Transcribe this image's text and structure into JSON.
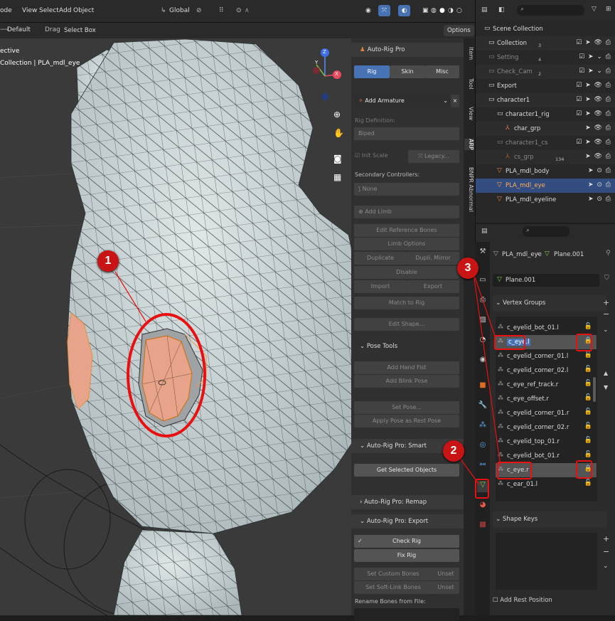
{
  "header": {
    "mode": "ode",
    "menus": [
      "View",
      "Select",
      "Add",
      "Object"
    ],
    "orientation": "Global",
    "pivot": "Default",
    "drag_label": "Drag:",
    "drag_value": "Select Box",
    "options_label": "Options"
  },
  "viewport": {
    "view_name": "ective",
    "object_info": "Collection | PLA_mdl_eye",
    "axis_x": "X",
    "axis_y": "Y",
    "axis_z": "Z"
  },
  "npanel": {
    "title": "Auto-Rig Pro",
    "tabs": [
      "Rig",
      "Skin",
      "Misc"
    ],
    "add_armature": "Add Armature",
    "rig_definition_label": "Rig Definition:",
    "rig_definition_value": "Biped",
    "init_scale": "Init Scale",
    "legacy": "Legacy...",
    "secondary_controllers": "Secondary Controllers:",
    "secondary_value": "None",
    "add_limb": "Add Limb",
    "edit_reference_bones": "Edit Reference Bones",
    "limb_options": "Limb Options",
    "duplicate": "Duplicate",
    "dupli_mirror": "Dupli. Mirror",
    "disable": "Disable",
    "import": "Import",
    "export": "Export",
    "match_to_rig": "Match to Rig",
    "edit_shape": "Edit Shape...",
    "pose_tools": "Pose Tools",
    "add_hand_fist": "Add Hand Fist",
    "add_blink_pose": "Add Blink Pose",
    "set_pose": "Set Pose...",
    "apply_pose": "Apply Pose as Rest Pose",
    "smart_title": "Auto-Rig Pro: Smart",
    "get_selected": "Get Selected Objects",
    "remap_title": "Auto-Rig Pro: Remap",
    "export_title": "Auto-Rig Pro: Export",
    "check_rig": "Check Rig",
    "fix_rig": "Fix Rig",
    "set_custom_bones": "Set Custom Bones",
    "unset": "Unset",
    "set_softlink": "Set Soft-Link Bones",
    "unset2": "Unset",
    "rename_bones": "Rename Bones from File:"
  },
  "ntabs": [
    "Item",
    "Tool",
    "View",
    "ARP",
    "BNPR Abnormal"
  ],
  "outliner": {
    "rows": [
      {
        "name": "Scene Collection"
      },
      {
        "name": "Collection",
        "badge": "3"
      },
      {
        "name": "Setting",
        "badge": "4"
      },
      {
        "name": "Check_Cam",
        "badge": "2"
      },
      {
        "name": "Export"
      },
      {
        "name": "character1"
      },
      {
        "name": "character1_rig"
      },
      {
        "name": "char_grp"
      },
      {
        "name": "character1_cs"
      },
      {
        "name": "cs_grp",
        "badge": "134"
      },
      {
        "name": "PLA_mdl_body"
      },
      {
        "name": "PLA_mdl_eye"
      },
      {
        "name": "PLA_mdl_eyeline"
      }
    ]
  },
  "properties": {
    "breadcrumb_object": "PLA_mdl_eye",
    "breadcrumb_mesh": "Plane.001",
    "mesh_name": "Plane.001",
    "vertex_groups_title": "Vertex Groups",
    "vertex_groups": [
      "c_eyelid_bot_01.l",
      "c_eye.l",
      "c_eyelid_corner_01.l",
      "c_eyelid_corner_02.l",
      "c_eye_ref_track.r",
      "c_eye_offset.r",
      "c_eyelid_corner_01.r",
      "c_eyelid_corner_02.r",
      "c_eyelid_top_01.r",
      "c_eyelid_bot_01.r",
      "c_eye.r",
      "c_ear_01.l"
    ],
    "shape_keys_title": "Shape Keys",
    "add_rest_position": "Add Rest Position"
  },
  "annotations": [
    "1",
    "2",
    "3"
  ],
  "colors": {
    "annotation_red": "#e81010",
    "selection_blue": "#4772b3",
    "mesh_body": "#c9d3d4",
    "eye_fill": "#e8a48a"
  }
}
